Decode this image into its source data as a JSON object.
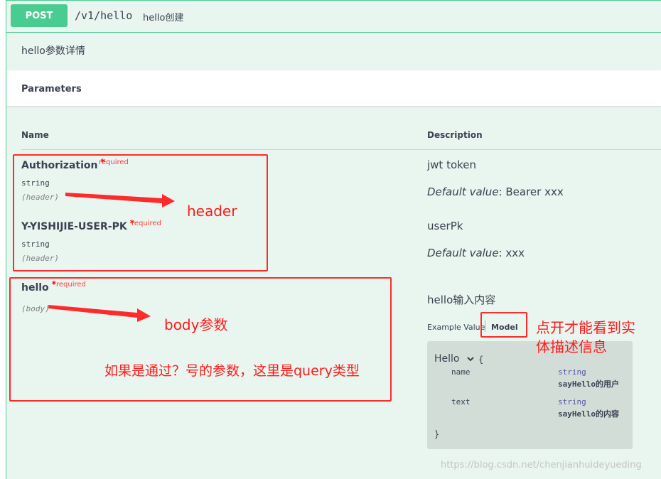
{
  "operation": {
    "method": "POST",
    "path": "/v1/hello",
    "summary": "hello创建",
    "description": "hello参数详情"
  },
  "parameters_section": {
    "title": "Parameters",
    "col_name": "Name",
    "col_description": "Description"
  },
  "params": [
    {
      "name": "Authorization",
      "star": "*",
      "required": "required",
      "type": "string",
      "in": "(header)",
      "description": "jwt token",
      "default_label": "Default value",
      "default_value": ": Bearer xxx"
    },
    {
      "name": "Y-YISHIJIE-USER-PK",
      "star": "*",
      "required": "required",
      "type": "string",
      "in": "(header)",
      "description": "userPk",
      "default_label": "Default value",
      "default_value": ": xxx"
    },
    {
      "name": "hello",
      "star": "*",
      "required": "required",
      "in": "(body)",
      "description": "hello输入内容"
    }
  ],
  "model_tabs": {
    "example": "Example Value",
    "model": "Model"
  },
  "model": {
    "title": "Hello",
    "open_brace": "{",
    "close_brace": "}",
    "props": [
      {
        "name": "name",
        "type": "string",
        "description": "sayHello的用户"
      },
      {
        "name": "text",
        "type": "string",
        "description": "sayHello的内容"
      }
    ]
  },
  "annotations": {
    "header": "header",
    "body": "body参数",
    "query_note": "如果是通过？号的参数，这里是query类型",
    "model_note_line1": "点开才能看到实",
    "model_note_line2": "体描述信息"
  },
  "colors": {
    "post_green": "#49cc90",
    "annotation_red": "#ff2a2a",
    "panel_bg": "#e9f5ef"
  },
  "watermark": "https://blog.csdn.net/chenjianhuideyueding"
}
